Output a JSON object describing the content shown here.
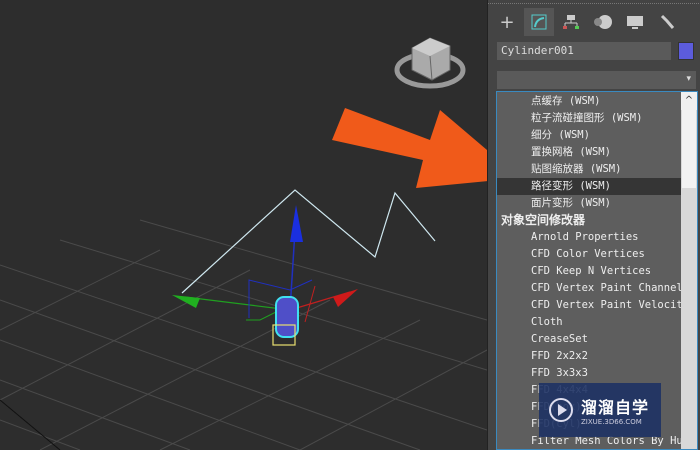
{
  "panel": {
    "tabs": [
      {
        "icon": "plus-icon"
      },
      {
        "icon": "modify-icon"
      },
      {
        "icon": "hierarchy-icon"
      },
      {
        "icon": "motion-icon"
      },
      {
        "icon": "display-icon"
      },
      {
        "icon": "utilities-icon"
      }
    ],
    "object_name": "Cylinder001",
    "object_color": "#5c5cdc",
    "dropdown_arrow": "▾",
    "scroll_up": "^",
    "list": [
      {
        "label": "点缓存 (WSM)"
      },
      {
        "label": "粒子流碰撞图形 (WSM)"
      },
      {
        "label": "细分 (WSM)"
      },
      {
        "label": "置换网格 (WSM)"
      },
      {
        "label": "贴图缩放器 (WSM)"
      },
      {
        "label": "路径变形 (WSM)",
        "selected": true
      },
      {
        "label": "面片变形 (WSM)"
      },
      {
        "label": "对象空间修改器",
        "category": true
      },
      {
        "label": "Arnold Properties"
      },
      {
        "label": "CFD Color Vertices"
      },
      {
        "label": "CFD Keep N Vertices"
      },
      {
        "label": "CFD Vertex Paint Channel"
      },
      {
        "label": "CFD Vertex Paint Velocity"
      },
      {
        "label": "Cloth"
      },
      {
        "label": "CreaseSet"
      },
      {
        "label": "FFD 2x2x2"
      },
      {
        "label": "FFD 3x3x3"
      },
      {
        "label": "FFD 4x4x4"
      },
      {
        "label": "FFD(box)"
      },
      {
        "label": "FFD(cyl)"
      },
      {
        "label": "Filter Mesh Colors By Hue"
      }
    ]
  },
  "watermark": {
    "title": "溜溜自学",
    "url": "ZIXUE.3D66.COM"
  },
  "colors": {
    "arrow": "#f05a1a",
    "selection": "#3a8ac0"
  }
}
